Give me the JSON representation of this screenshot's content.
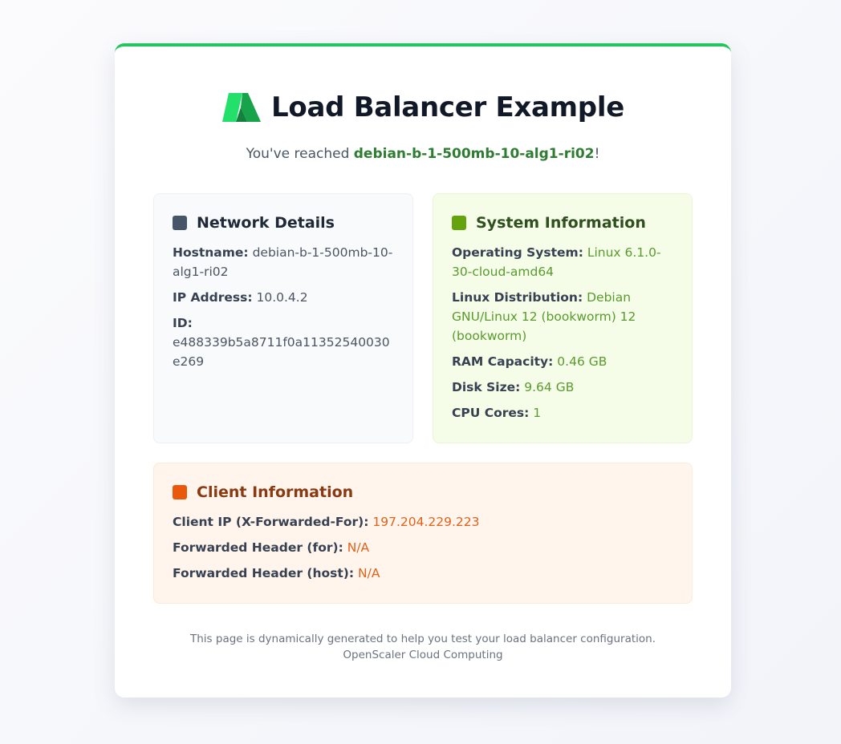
{
  "header": {
    "title": "Load Balancer Example",
    "reached_prefix": "You've reached ",
    "reached_host": "debian-b-1-500mb-10-alg1-ri02",
    "reached_suffix": "!"
  },
  "network": {
    "title": "Network Details",
    "icon": "square-icon",
    "color": "#475569",
    "rows": [
      {
        "label": "Hostname:",
        "value": "debian-b-1-500mb-10-alg1-ri02"
      },
      {
        "label": "IP Address:",
        "value": "10.0.4.2"
      },
      {
        "label": "ID:",
        "value": "e488339b5a8711f0a11352540030e269"
      }
    ]
  },
  "system": {
    "title": "System Information",
    "icon": "square-icon",
    "color": "#65a30d",
    "rows": [
      {
        "label": "Operating System:",
        "value": "Linux 6.1.0-30-cloud-amd64"
      },
      {
        "label": "Linux Distribution:",
        "value": "Debian GNU/Linux 12 (bookworm) 12 (bookworm)"
      },
      {
        "label": "RAM Capacity:",
        "value": "0.46 GB"
      },
      {
        "label": "Disk Size:",
        "value": "9.64 GB"
      },
      {
        "label": "CPU Cores:",
        "value": "1"
      }
    ]
  },
  "client": {
    "title": "Client Information",
    "icon": "square-icon",
    "color": "#ea580c",
    "rows": [
      {
        "label": "Client IP (X-Forwarded-For):",
        "value": "197.204.229.223"
      },
      {
        "label": "Forwarded Header (for):",
        "value": "N/A"
      },
      {
        "label": "Forwarded Header (host):",
        "value": "N/A"
      }
    ]
  },
  "footer": {
    "line1": "This page is dynamically generated to help you test your load balancer configuration.",
    "line2": "OpenScaler Cloud Computing"
  },
  "colors": {
    "accent": "#22c55e",
    "host_text": "#2e7d32"
  }
}
